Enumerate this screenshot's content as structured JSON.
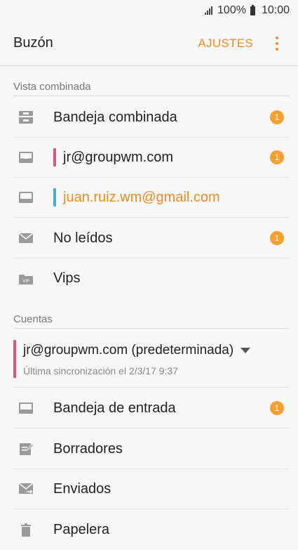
{
  "status": {
    "battery": "100%",
    "time": "10:00"
  },
  "appbar": {
    "title": "Buzón",
    "settings": "AJUSTES"
  },
  "sections": {
    "combined": "Vista combinada",
    "accounts": "Cuentas"
  },
  "combined_items": [
    {
      "label": "Bandeja combinada",
      "badge": "1"
    },
    {
      "label": "jr@groupwm.com",
      "badge": "1"
    },
    {
      "label": "juan.ruiz.wm@gmail.com"
    },
    {
      "label": "No leídos",
      "badge": "1"
    },
    {
      "label": "Vips"
    }
  ],
  "account": {
    "name": "jr@groupwm.com (predeterminada)",
    "sync": "Última sincronización el 2/3/17  9:37"
  },
  "folders": [
    {
      "label": "Bandeja de entrada",
      "badge": "1"
    },
    {
      "label": "Borradores"
    },
    {
      "label": "Enviados"
    },
    {
      "label": "Papelera"
    }
  ],
  "colors": {
    "accent": "#f08a24",
    "badge": "#f5a031",
    "account1": "#d9587e",
    "account2": "#3fb0d8"
  }
}
